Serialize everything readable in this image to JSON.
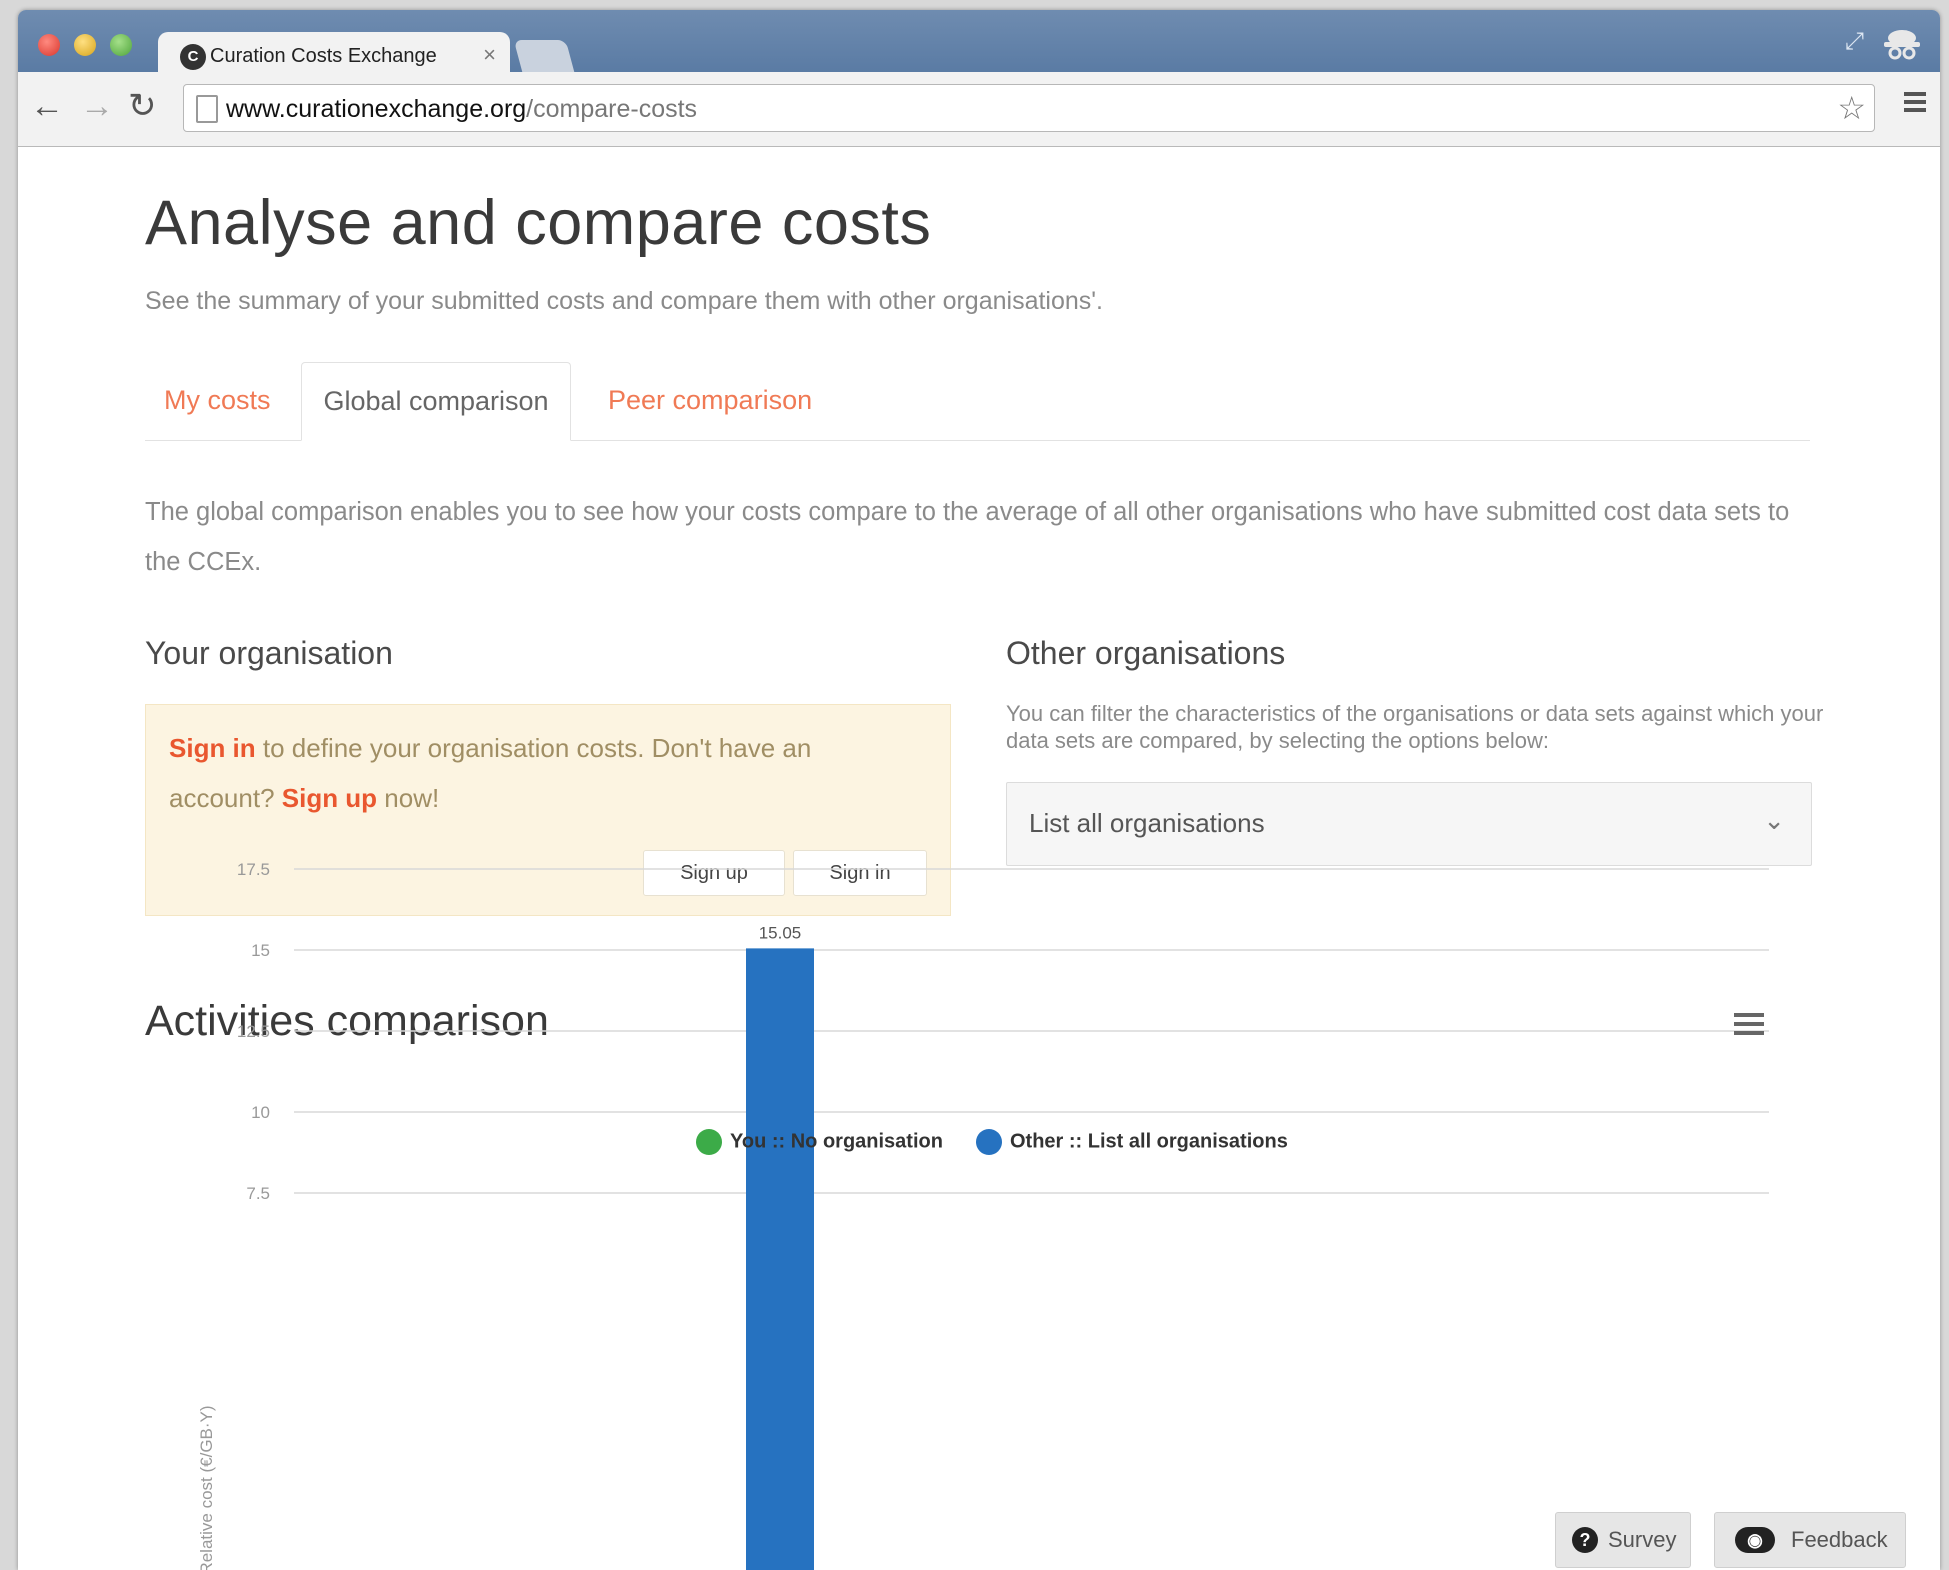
{
  "browser": {
    "tab_title": "Curation Costs Exchange",
    "tab_close": "×",
    "url_host": "www.curationexchange.org",
    "url_path": "/compare-costs",
    "favicon_text": "C"
  },
  "page": {
    "title": "Analyse and compare costs",
    "subtitle": "See the summary of your submitted costs and compare them with other organisations'.",
    "tabs": [
      {
        "label": "My costs"
      },
      {
        "label": "Global comparison"
      },
      {
        "label": "Peer comparison"
      }
    ],
    "intro": "The global comparison enables you to see how your costs compare to the average of all other organisations who have submitted cost data sets to the CCEx.",
    "your_org": {
      "heading": "Your organisation",
      "sign_in_link": "Sign in",
      "text_1": " to define your organisation costs. Don't have an account? ",
      "sign_up_link": "Sign up",
      "text_2": " now!",
      "signup_button": "Sign up",
      "signin_button": "Sign in"
    },
    "other_orgs": {
      "heading": "Other organisations",
      "help": "You can filter the characteristics of the organisations or data sets against which your data sets are compared, by selecting the options below:",
      "select_value": "List all organisations",
      "chevron": "⌄"
    },
    "activities_heading": "Activities comparison"
  },
  "colors": {
    "accent_link": "#f07a55",
    "series_you": "#3cab48",
    "series_other": "#2672c0"
  },
  "chart_data": {
    "type": "bar",
    "ylabel": "Relative cost (€/GB·Y)",
    "ylim": [
      0,
      17.5
    ],
    "y_ticks": [
      "17.5",
      "15",
      "12.5",
      "10",
      "7.5"
    ],
    "series": [
      {
        "name": "You :: No organisation",
        "values": []
      },
      {
        "name": "Other :: List all organisations",
        "values": [
          15.05
        ]
      }
    ],
    "data_labels": [
      "15.05"
    ],
    "legend_position": "top",
    "grid": true
  },
  "widgets": {
    "survey": "Survey",
    "feedback": "Feedback",
    "survey_icon_glyph": "?",
    "feedback_icon_glyph": "◉"
  }
}
